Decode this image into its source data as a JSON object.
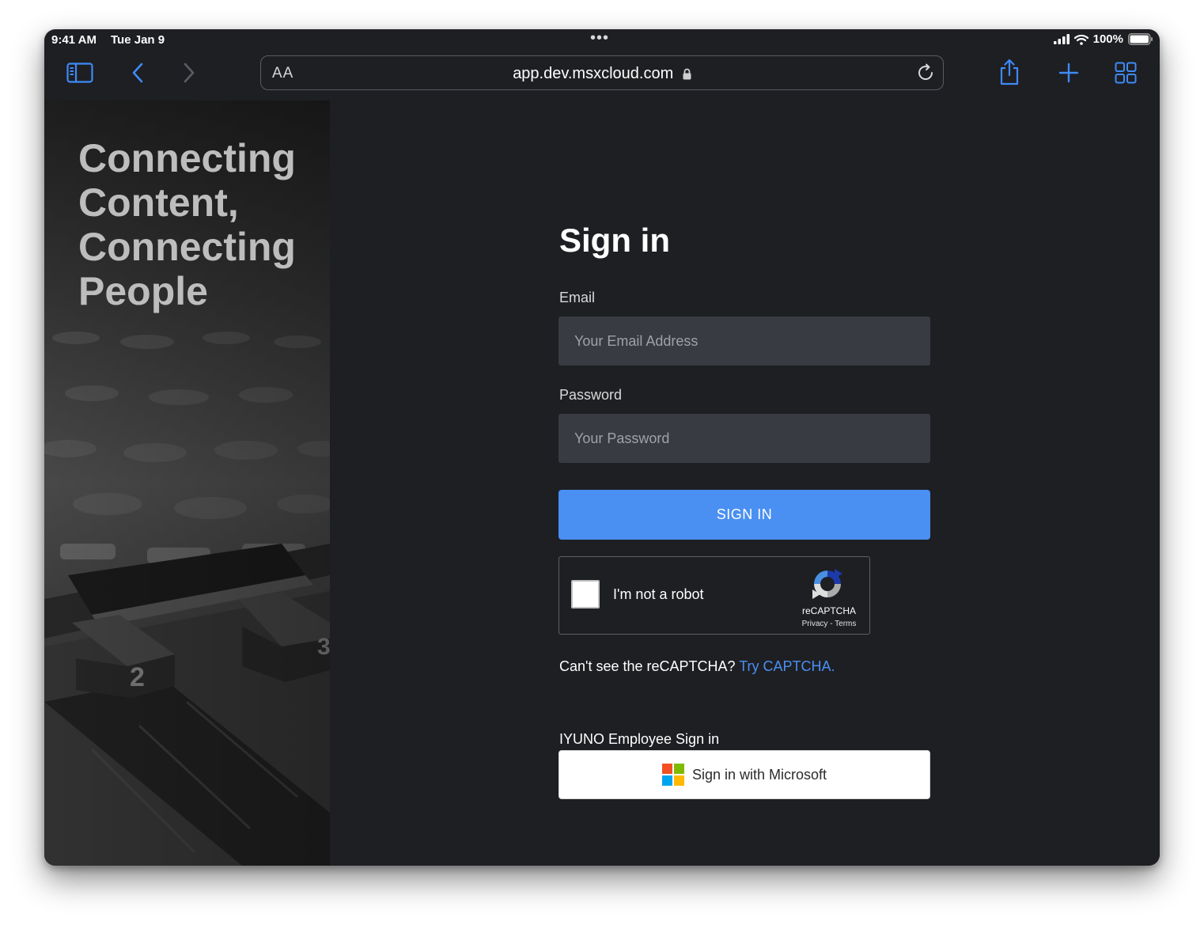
{
  "status_bar": {
    "time": "9:41 AM",
    "date": "Tue Jan 9",
    "battery": "100%"
  },
  "browser": {
    "text_size_label": "AA",
    "url": "app.dev.msxcloud.com"
  },
  "hero": {
    "title_lines": [
      "Connecting",
      "Content,",
      "Connecting",
      "People"
    ]
  },
  "signin": {
    "title": "Sign in",
    "email_label": "Email",
    "email_placeholder": "Your Email Address",
    "email_value": "",
    "password_label": "Password",
    "password_placeholder": "Your Password",
    "password_value": "",
    "submit_label": "SIGN IN"
  },
  "recaptcha": {
    "checkbox_label": "I'm not a robot",
    "brand": "reCAPTCHA",
    "privacy": "Privacy",
    "separator": " - ",
    "terms": "Terms"
  },
  "captcha_fallback": {
    "prompt": "Can't see the reCAPTCHA? ",
    "link": "Try CAPTCHA."
  },
  "employee": {
    "label": "IYUNO Employee Sign in",
    "microsoft_button": "Sign in with Microsoft"
  },
  "colors": {
    "accent": "#4a8ff2",
    "toolbar_icon": "#3e8af7",
    "background": "#1e1f23",
    "input_bg": "#393b42"
  }
}
